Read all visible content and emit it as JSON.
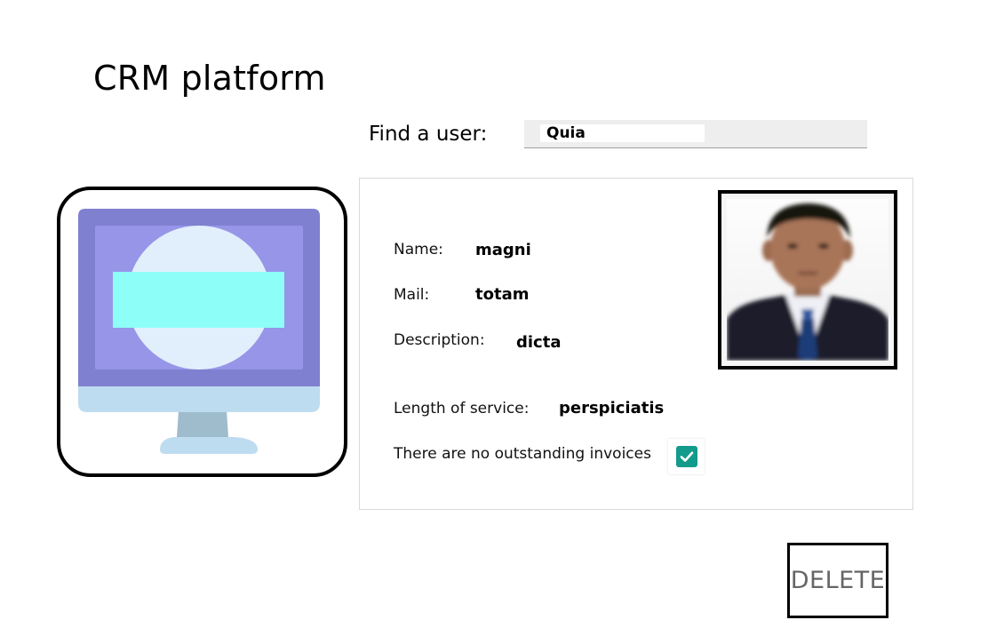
{
  "app": {
    "title": "CRM platform"
  },
  "search": {
    "label": "Find a user:",
    "value": "Quia"
  },
  "illustration": {
    "icon": "desktop-monitor-icon",
    "colors": {
      "monitor_frame": "#7f80d0",
      "screen": "#9695e8",
      "circle": "#e1effc",
      "banner": "#8efff8",
      "stand_base": "#bedcf0",
      "stand_neck": "#9fbccc"
    }
  },
  "profile": {
    "fields": {
      "name": {
        "label": "Name:",
        "value": "magni"
      },
      "mail": {
        "label": "Mail:",
        "value": "totam"
      },
      "description": {
        "label": "Description:",
        "value": "dicta"
      },
      "service": {
        "label": "Length of service:",
        "value": "perspiciatis"
      }
    },
    "invoices": {
      "label": "There are no outstanding invoices",
      "checked": true
    },
    "photo": {
      "icon": "user-photo"
    }
  },
  "actions": {
    "delete_label": "DELETE"
  },
  "colors": {
    "checkbox_accent": "#129b8a",
    "search_bg": "#eeeeee",
    "delete_text": "#666666"
  }
}
